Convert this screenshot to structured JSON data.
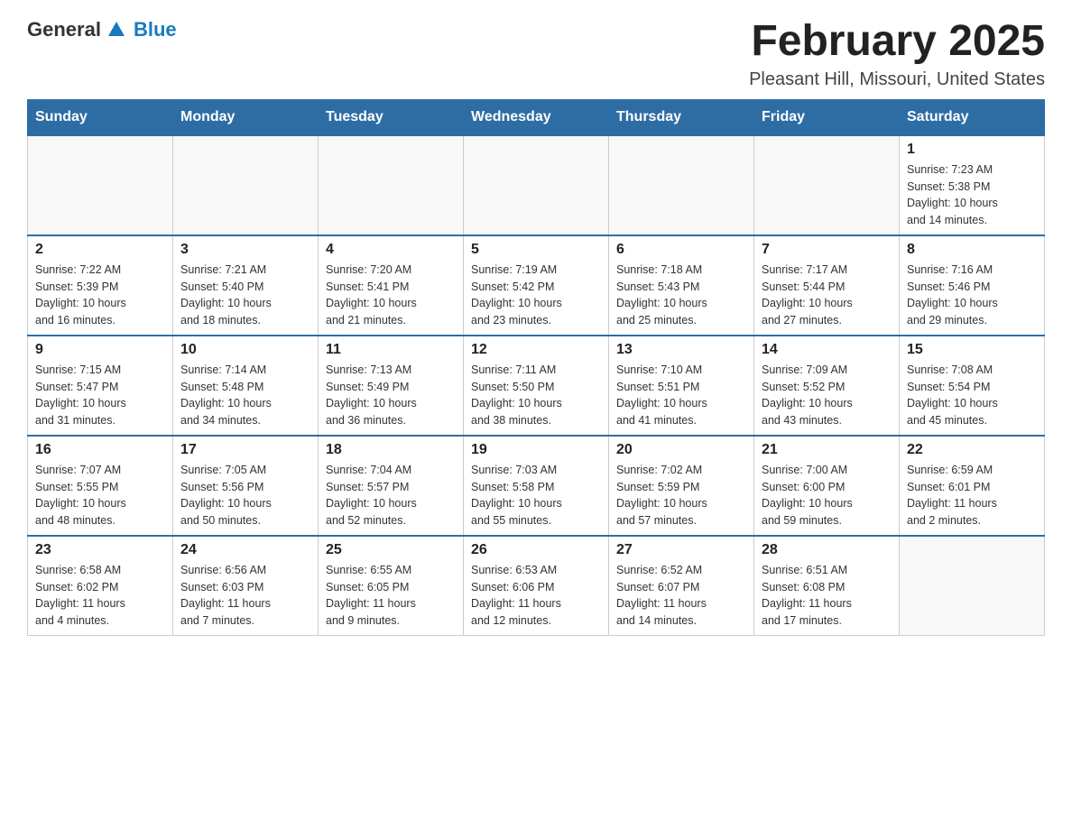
{
  "logo": {
    "text_general": "General",
    "text_blue": "Blue"
  },
  "title": "February 2025",
  "location": "Pleasant Hill, Missouri, United States",
  "days_of_week": [
    "Sunday",
    "Monday",
    "Tuesday",
    "Wednesday",
    "Thursday",
    "Friday",
    "Saturday"
  ],
  "weeks": [
    [
      {
        "day": "",
        "info": ""
      },
      {
        "day": "",
        "info": ""
      },
      {
        "day": "",
        "info": ""
      },
      {
        "day": "",
        "info": ""
      },
      {
        "day": "",
        "info": ""
      },
      {
        "day": "",
        "info": ""
      },
      {
        "day": "1",
        "info": "Sunrise: 7:23 AM\nSunset: 5:38 PM\nDaylight: 10 hours\nand 14 minutes."
      }
    ],
    [
      {
        "day": "2",
        "info": "Sunrise: 7:22 AM\nSunset: 5:39 PM\nDaylight: 10 hours\nand 16 minutes."
      },
      {
        "day": "3",
        "info": "Sunrise: 7:21 AM\nSunset: 5:40 PM\nDaylight: 10 hours\nand 18 minutes."
      },
      {
        "day": "4",
        "info": "Sunrise: 7:20 AM\nSunset: 5:41 PM\nDaylight: 10 hours\nand 21 minutes."
      },
      {
        "day": "5",
        "info": "Sunrise: 7:19 AM\nSunset: 5:42 PM\nDaylight: 10 hours\nand 23 minutes."
      },
      {
        "day": "6",
        "info": "Sunrise: 7:18 AM\nSunset: 5:43 PM\nDaylight: 10 hours\nand 25 minutes."
      },
      {
        "day": "7",
        "info": "Sunrise: 7:17 AM\nSunset: 5:44 PM\nDaylight: 10 hours\nand 27 minutes."
      },
      {
        "day": "8",
        "info": "Sunrise: 7:16 AM\nSunset: 5:46 PM\nDaylight: 10 hours\nand 29 minutes."
      }
    ],
    [
      {
        "day": "9",
        "info": "Sunrise: 7:15 AM\nSunset: 5:47 PM\nDaylight: 10 hours\nand 31 minutes."
      },
      {
        "day": "10",
        "info": "Sunrise: 7:14 AM\nSunset: 5:48 PM\nDaylight: 10 hours\nand 34 minutes."
      },
      {
        "day": "11",
        "info": "Sunrise: 7:13 AM\nSunset: 5:49 PM\nDaylight: 10 hours\nand 36 minutes."
      },
      {
        "day": "12",
        "info": "Sunrise: 7:11 AM\nSunset: 5:50 PM\nDaylight: 10 hours\nand 38 minutes."
      },
      {
        "day": "13",
        "info": "Sunrise: 7:10 AM\nSunset: 5:51 PM\nDaylight: 10 hours\nand 41 minutes."
      },
      {
        "day": "14",
        "info": "Sunrise: 7:09 AM\nSunset: 5:52 PM\nDaylight: 10 hours\nand 43 minutes."
      },
      {
        "day": "15",
        "info": "Sunrise: 7:08 AM\nSunset: 5:54 PM\nDaylight: 10 hours\nand 45 minutes."
      }
    ],
    [
      {
        "day": "16",
        "info": "Sunrise: 7:07 AM\nSunset: 5:55 PM\nDaylight: 10 hours\nand 48 minutes."
      },
      {
        "day": "17",
        "info": "Sunrise: 7:05 AM\nSunset: 5:56 PM\nDaylight: 10 hours\nand 50 minutes."
      },
      {
        "day": "18",
        "info": "Sunrise: 7:04 AM\nSunset: 5:57 PM\nDaylight: 10 hours\nand 52 minutes."
      },
      {
        "day": "19",
        "info": "Sunrise: 7:03 AM\nSunset: 5:58 PM\nDaylight: 10 hours\nand 55 minutes."
      },
      {
        "day": "20",
        "info": "Sunrise: 7:02 AM\nSunset: 5:59 PM\nDaylight: 10 hours\nand 57 minutes."
      },
      {
        "day": "21",
        "info": "Sunrise: 7:00 AM\nSunset: 6:00 PM\nDaylight: 10 hours\nand 59 minutes."
      },
      {
        "day": "22",
        "info": "Sunrise: 6:59 AM\nSunset: 6:01 PM\nDaylight: 11 hours\nand 2 minutes."
      }
    ],
    [
      {
        "day": "23",
        "info": "Sunrise: 6:58 AM\nSunset: 6:02 PM\nDaylight: 11 hours\nand 4 minutes."
      },
      {
        "day": "24",
        "info": "Sunrise: 6:56 AM\nSunset: 6:03 PM\nDaylight: 11 hours\nand 7 minutes."
      },
      {
        "day": "25",
        "info": "Sunrise: 6:55 AM\nSunset: 6:05 PM\nDaylight: 11 hours\nand 9 minutes."
      },
      {
        "day": "26",
        "info": "Sunrise: 6:53 AM\nSunset: 6:06 PM\nDaylight: 11 hours\nand 12 minutes."
      },
      {
        "day": "27",
        "info": "Sunrise: 6:52 AM\nSunset: 6:07 PM\nDaylight: 11 hours\nand 14 minutes."
      },
      {
        "day": "28",
        "info": "Sunrise: 6:51 AM\nSunset: 6:08 PM\nDaylight: 11 hours\nand 17 minutes."
      },
      {
        "day": "",
        "info": ""
      }
    ]
  ]
}
